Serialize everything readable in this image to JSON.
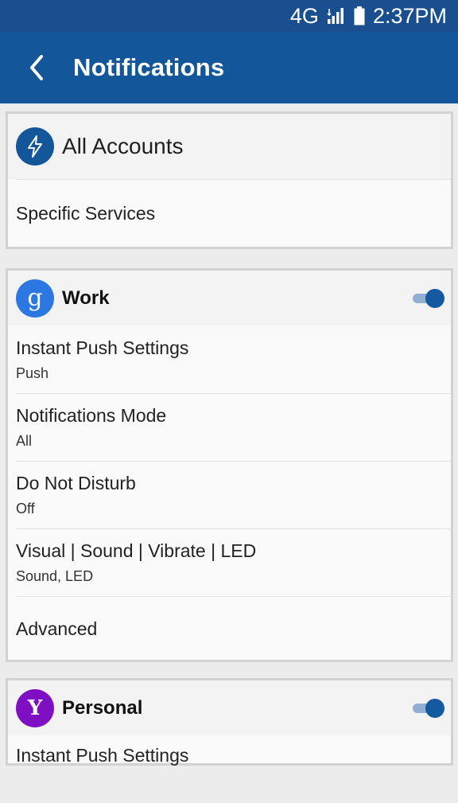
{
  "status_bar": {
    "network": "4G",
    "time": "2:37PM",
    "icons": [
      "signal-icon",
      "battery-icon"
    ]
  },
  "app_bar": {
    "title": "Notifications",
    "back_icon": "chevron-left-icon"
  },
  "all_accounts": {
    "title": "All Accounts",
    "icon": "lightning-icon",
    "rows": [
      {
        "primary": "Specific Services"
      }
    ]
  },
  "work": {
    "title": "Work",
    "icon_letter": "g",
    "icon_color": "#2d77e3",
    "enabled": true,
    "rows": [
      {
        "primary": "Instant Push Settings",
        "secondary": "Push"
      },
      {
        "primary": "Notifications Mode",
        "secondary": "All"
      },
      {
        "primary": "Do Not Disturb",
        "secondary": "Off"
      },
      {
        "primary": "Visual | Sound | Vibrate | LED",
        "secondary": "Sound, LED"
      },
      {
        "primary": "Advanced"
      }
    ]
  },
  "personal": {
    "title": "Personal",
    "icon_letter": "Y",
    "icon_color": "#7f0fc2",
    "enabled": true,
    "rows": [
      {
        "primary": "Instant Push Settings"
      }
    ]
  },
  "colors": {
    "status_bar": "#1a4f8f",
    "app_bar": "#135699",
    "accent": "#145aa0"
  }
}
